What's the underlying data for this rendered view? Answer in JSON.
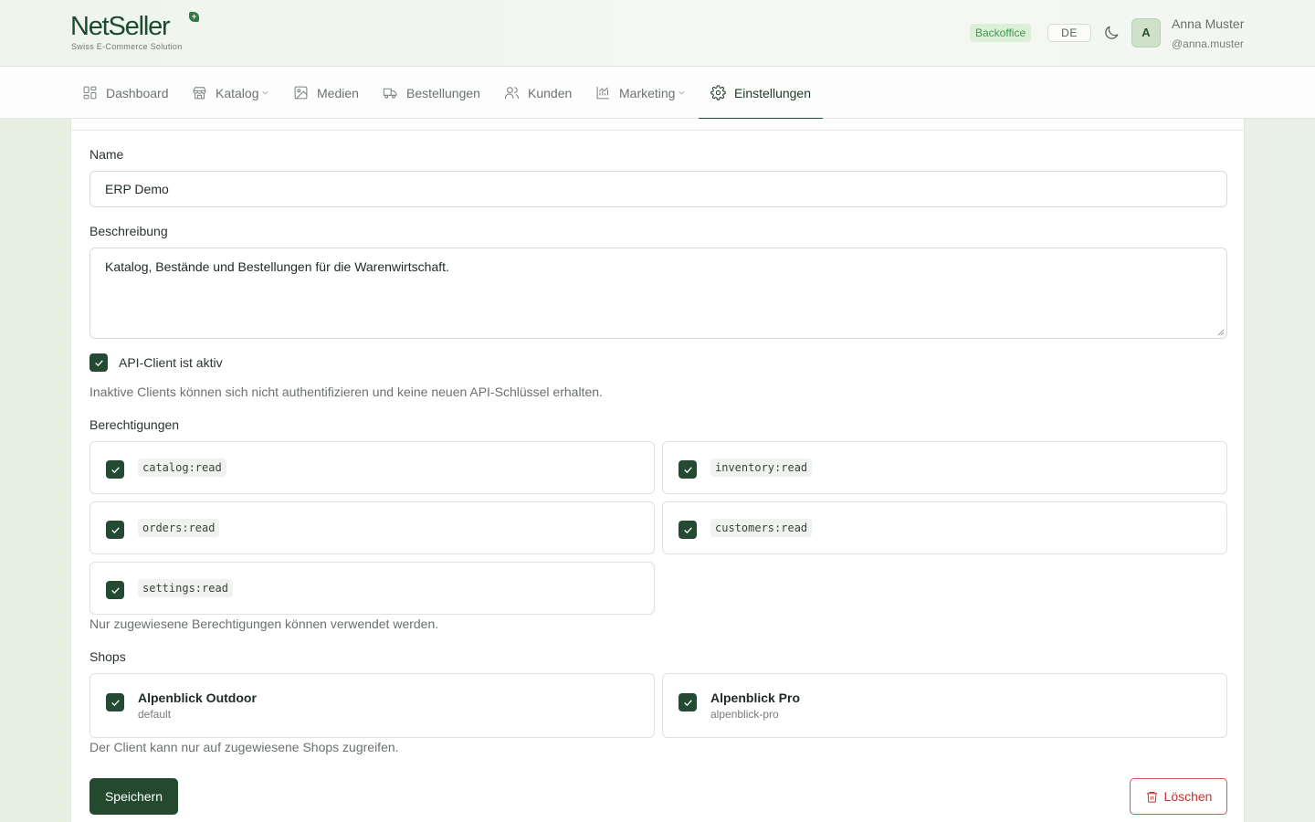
{
  "header": {
    "logo_text": "NetSeller",
    "logo_badge": "+",
    "logo_subtitle": "Swiss E-Commerce Solution",
    "backoffice_tag": "Backoffice",
    "language": "DE",
    "theme_icon": "moon-icon",
    "user": {
      "avatar_initial": "A",
      "name": "Anna Muster",
      "handle": "@anna.muster"
    }
  },
  "nav": {
    "items": [
      {
        "label": "Dashboard",
        "icon": "dashboard-icon"
      },
      {
        "label": "Katalog",
        "icon": "store-icon",
        "has_dropdown": true
      },
      {
        "label": "Medien",
        "icon": "image-icon"
      },
      {
        "label": "Bestellungen",
        "icon": "truck-icon"
      },
      {
        "label": "Kunden",
        "icon": "users-icon"
      },
      {
        "label": "Marketing",
        "icon": "chart-icon",
        "has_dropdown": true
      },
      {
        "label": "Einstellungen",
        "icon": "gear-icon",
        "active": true
      }
    ]
  },
  "form": {
    "name_label": "Name",
    "name_value": "ERP Demo",
    "description_label": "Beschreibung",
    "description_value": "Katalog, Bestände und Bestellungen für die Warenwirtschaft.",
    "active_label": "API-Client ist aktiv",
    "active_checked": true,
    "active_help": "Inaktive Clients können sich nicht authentifizieren und keine neuen API-Schlüssel erhalten.",
    "permissions_label": "Berechtigungen",
    "permissions": [
      {
        "code": "catalog:read",
        "checked": true
      },
      {
        "code": "inventory:read",
        "checked": true
      },
      {
        "code": "orders:read",
        "checked": true
      },
      {
        "code": "customers:read",
        "checked": true
      },
      {
        "code": "settings:read",
        "checked": true
      }
    ],
    "permissions_help": "Nur zugewiesene Berechtigungen können verwendet werden.",
    "shops_label": "Shops",
    "shops": [
      {
        "name": "Alpenblick Outdoor",
        "slug": "default",
        "checked": true
      },
      {
        "name": "Alpenblick Pro",
        "slug": "alpenblick-pro",
        "checked": true
      }
    ],
    "shops_help": "Der Client kann nur auf zugewiesene Shops zugreifen.",
    "save_label": "Speichern",
    "delete_label": "Löschen"
  },
  "colors": {
    "primary": "#24492f",
    "danger": "#c9302c",
    "backoffice_bg": "#dcefd9",
    "backoffice_text": "#3a9a4e"
  }
}
